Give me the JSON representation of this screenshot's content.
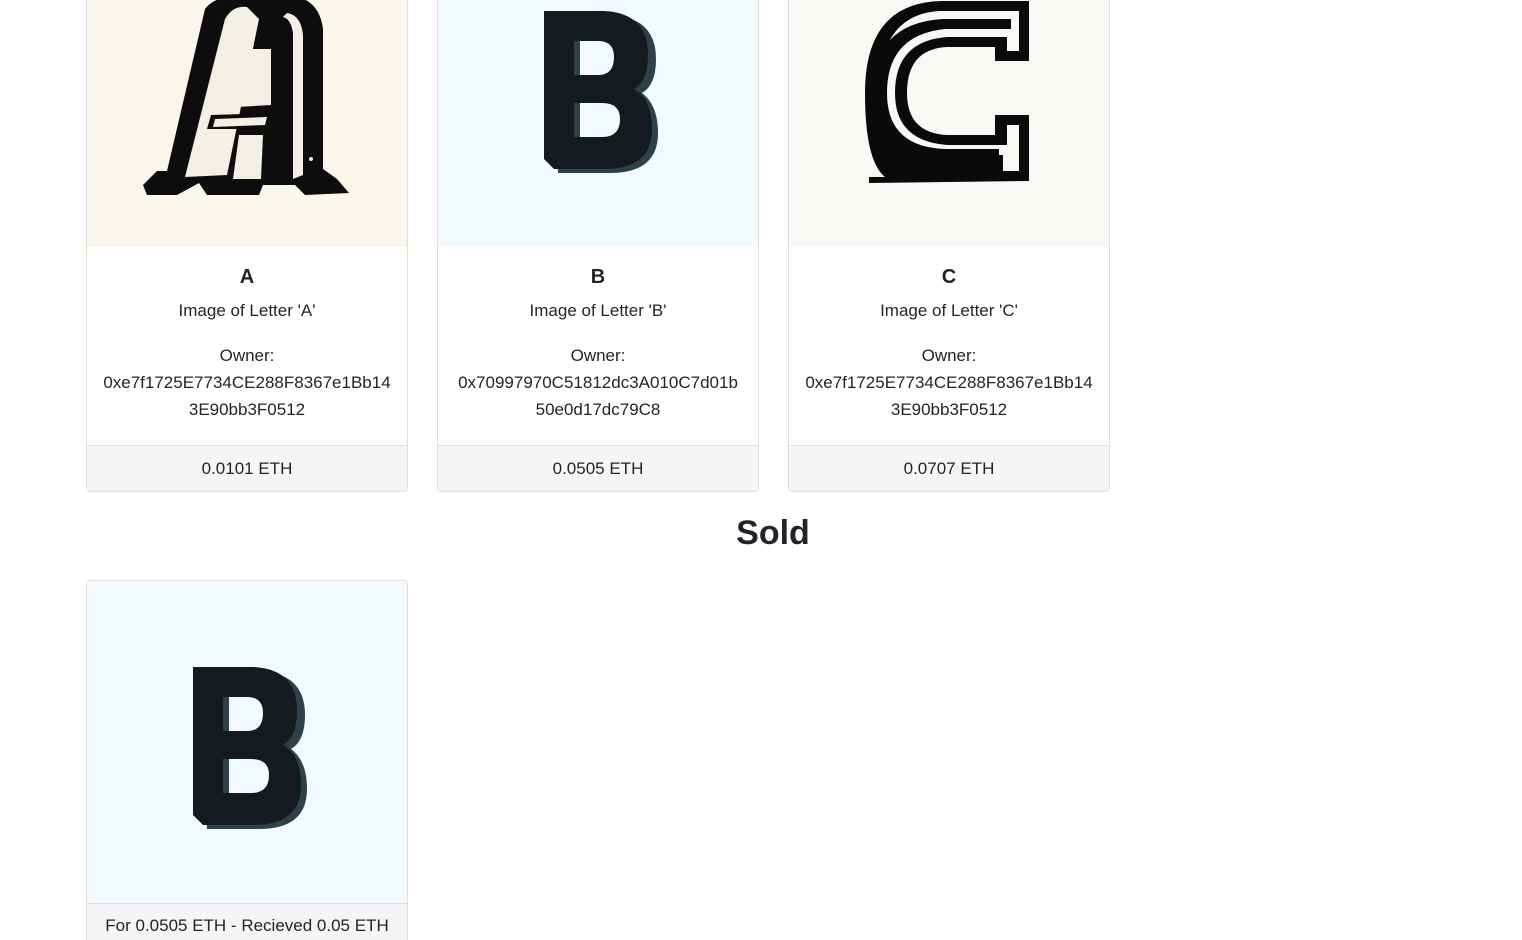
{
  "listings": [
    {
      "title": "A",
      "description": "Image of Letter 'A'",
      "owner_label": "Owner:",
      "owner": "0xe7f1725E7734CE288F8367e1Bb143E90bb3F0512",
      "price": "0.0101 ETH"
    },
    {
      "title": "B",
      "description": "Image of Letter 'B'",
      "owner_label": "Owner:",
      "owner": "0x70997970C51812dc3A010C7d01b50e0d17dc79C8",
      "price": "0.0505 ETH"
    },
    {
      "title": "C",
      "description": "Image of Letter 'C'",
      "owner_label": "Owner:",
      "owner": "0xe7f1725E7734CE288F8367e1Bb143E90bb3F0512",
      "price": "0.0707 ETH"
    }
  ],
  "sold": {
    "heading": "Sold",
    "items": [
      {
        "image_letter": "B",
        "summary": "For 0.0505 ETH - Recieved 0.05 ETH"
      }
    ]
  },
  "colors": {
    "card_border": "#dfdfdf",
    "footer_bg": "#f5f5f5",
    "text": "#212529",
    "letter_dark": "#141a1e",
    "letter_shadow": "#2e4048"
  }
}
